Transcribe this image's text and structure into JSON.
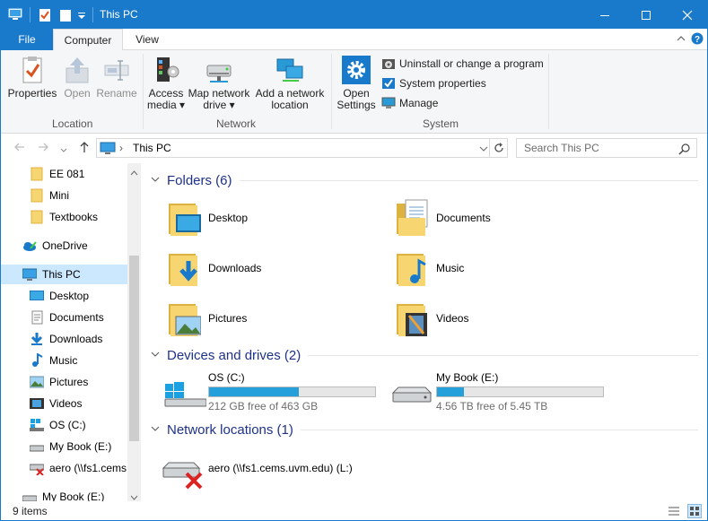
{
  "window": {
    "title": "This PC",
    "controls": {
      "minimize": "—",
      "maximize": "☐",
      "close": "✕"
    }
  },
  "tabs": {
    "file": "File",
    "computer": "Computer",
    "view": "View"
  },
  "ribbon": {
    "location": {
      "label": "Location",
      "properties": "Properties",
      "open": "Open",
      "rename": "Rename"
    },
    "network": {
      "label": "Network",
      "access_media": "Access media",
      "map_drive": "Map network drive",
      "add_location": "Add a network location"
    },
    "system": {
      "label": "System",
      "open_settings": "Open Settings",
      "uninstall": "Uninstall or change a program",
      "system_properties": "System properties",
      "manage": "Manage"
    }
  },
  "address": {
    "path": "This PC",
    "search_placeholder": "Search This PC"
  },
  "nav": {
    "items": [
      {
        "label": "EE 081",
        "icon": "folder-icon"
      },
      {
        "label": "Mini",
        "icon": "folder-icon"
      },
      {
        "label": "Textbooks",
        "icon": "folder-icon"
      },
      {
        "label": "OneDrive",
        "icon": "onedrive-icon"
      },
      {
        "label": "This PC",
        "icon": "computer-icon"
      },
      {
        "label": "Desktop",
        "icon": "desktop-icon"
      },
      {
        "label": "Documents",
        "icon": "documents-icon"
      },
      {
        "label": "Downloads",
        "icon": "downloads-icon"
      },
      {
        "label": "Music",
        "icon": "music-icon"
      },
      {
        "label": "Pictures",
        "icon": "pictures-icon"
      },
      {
        "label": "Videos",
        "icon": "videos-icon"
      },
      {
        "label": "OS (C:)",
        "icon": "windows-drive-icon"
      },
      {
        "label": "My Book (E:)",
        "icon": "drive-icon"
      },
      {
        "label": "aero (\\\\fs1.cems.uvm.edu) (L:)",
        "icon": "disconnected-drive-icon"
      },
      {
        "label": "My Book (E:)",
        "icon": "drive-icon"
      }
    ]
  },
  "content": {
    "folders_header": "Folders (6)",
    "folders": [
      {
        "label": "Desktop",
        "icon": "desktop-folder-icon"
      },
      {
        "label": "Documents",
        "icon": "documents-folder-icon"
      },
      {
        "label": "Downloads",
        "icon": "downloads-folder-icon"
      },
      {
        "label": "Music",
        "icon": "music-folder-icon"
      },
      {
        "label": "Pictures",
        "icon": "pictures-folder-icon"
      },
      {
        "label": "Videos",
        "icon": "videos-folder-icon"
      }
    ],
    "drives_header": "Devices and drives (2)",
    "drives": [
      {
        "label": "OS (C:)",
        "free": "212 GB free of 463 GB",
        "used_fraction": 0.54
      },
      {
        "label": "My Book (E:)",
        "free": "4.56 TB free of 5.45 TB",
        "used_fraction": 0.16
      }
    ],
    "network_header": "Network locations (1)",
    "network": [
      {
        "label": "aero (\\\\fs1.cems.uvm.edu) (L:)"
      }
    ]
  },
  "status": {
    "items": "9 items"
  },
  "colors": {
    "accent": "#1979ca",
    "drive_bar": "#26a0da",
    "section_text": "#1e3287",
    "selected": "#cce8ff"
  }
}
